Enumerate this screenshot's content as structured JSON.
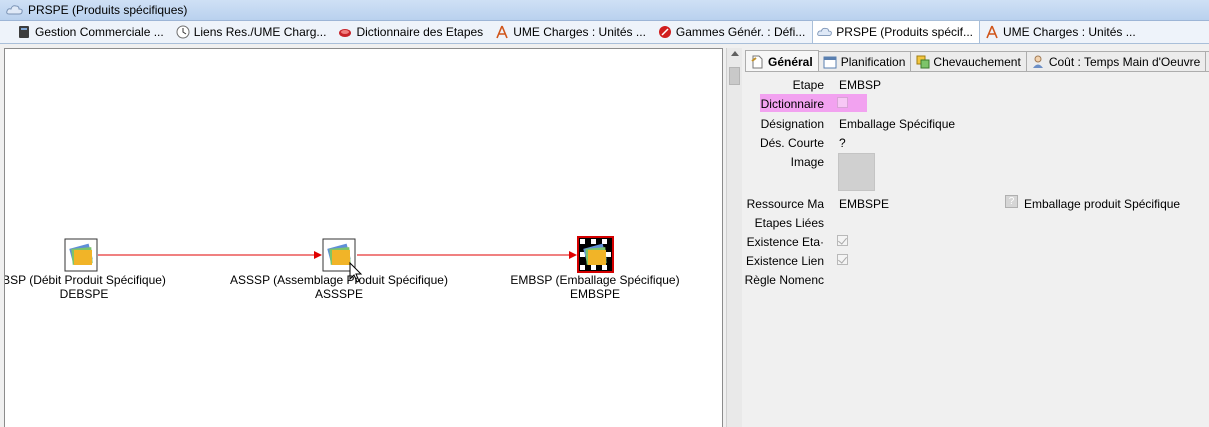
{
  "window": {
    "title": "PRSPE (Produits spécifiques)",
    "title_icon": "cloud-icon"
  },
  "doc_tabs": [
    {
      "label": "Gestion Commerciale ...",
      "icon": "server-icon",
      "active": false
    },
    {
      "label": "Liens Res./UME Charg...",
      "icon": "clock-icon",
      "active": false
    },
    {
      "label": "Dictionnaire des Etapes",
      "icon": "steak-icon",
      "active": false
    },
    {
      "label": "UME Charges : Unités ...",
      "icon": "compass-icon",
      "active": false
    },
    {
      "label": "Gammes Génér. : Défi...",
      "icon": "red-circle-icon",
      "active": false
    },
    {
      "label": "PRSPE (Produits spécif...",
      "icon": "cloud-icon",
      "active": true
    },
    {
      "label": "UME Charges : Unités ...",
      "icon": "compass-icon",
      "active": false
    }
  ],
  "diagram": {
    "nodes": [
      {
        "name": "BSP (Débit Produit Spécifique)",
        "code": "DEBSPE",
        "selected": false
      },
      {
        "name": "ASSSP (Assemblage Produit Spécifique)",
        "code": "ASSSPE",
        "selected": false
      },
      {
        "name": "EMBSP (Emballage Spécifique)",
        "code": "EMBSPE",
        "selected": true
      }
    ],
    "link_color": "#e00000"
  },
  "prop_tabs": [
    {
      "label": "Général",
      "icon": "document-icon",
      "active": true
    },
    {
      "label": "Planification",
      "icon": "calendar-icon",
      "active": false
    },
    {
      "label": "Chevauchement",
      "icon": "overlap-icon",
      "active": false
    },
    {
      "label": "Coût : Temps Main d'Oeuvre",
      "icon": "person-icon",
      "active": false
    }
  ],
  "properties": {
    "etape": {
      "label": "Etape",
      "value": "EMBSP"
    },
    "dictionnaire": {
      "label": "Dictionnaire",
      "checked": false,
      "highlight": "#f2a2f0"
    },
    "designation": {
      "label": "Désignation",
      "value": "Emballage Spécifique"
    },
    "des_courte": {
      "label": "Dés. Courte",
      "value": "?"
    },
    "image": {
      "label": "Image"
    },
    "ressource": {
      "label": "Ressource Ma",
      "value": "EMBSPE",
      "description": "Emballage produit Spécifique"
    },
    "etapes_liees": {
      "label": "Etapes Liées"
    },
    "existence_etape": {
      "label": "Existence Eta·",
      "checked": true
    },
    "existence_lien": {
      "label": "Existence Lien",
      "checked": true
    },
    "regle_nomenc": {
      "label": "Règle Nomenc"
    }
  }
}
